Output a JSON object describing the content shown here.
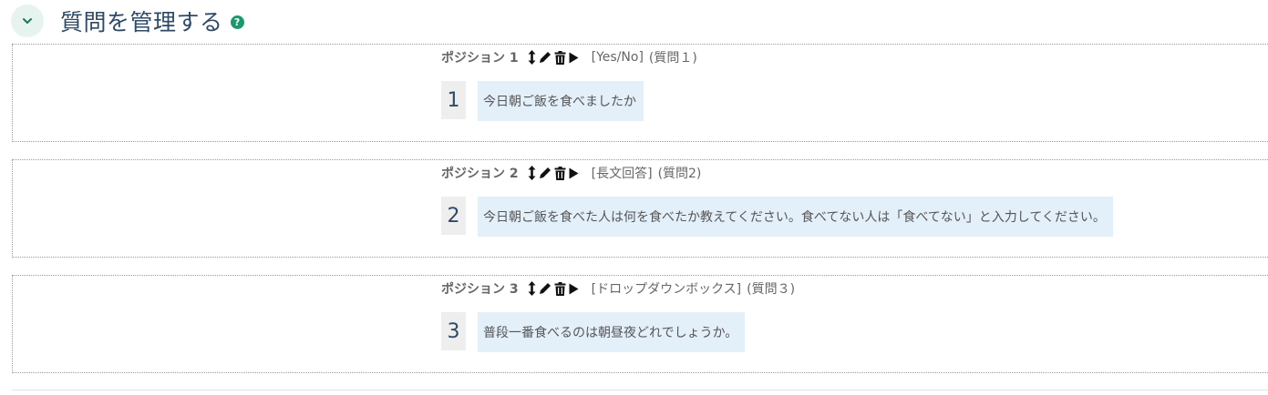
{
  "section": {
    "title": "質問を管理する",
    "help_icon_text": "?",
    "toggle_icon": "chevron-down-icon"
  },
  "colors": {
    "title": "#2e4a66",
    "toggle_bg": "#e6f3ee",
    "help_icon": "#1a9a6c",
    "question_text_bg": "#e3f0fa",
    "number_bg": "#eeeeee"
  },
  "questions": [
    {
      "position_label": "ポジション 1",
      "type": "[Yes/No]",
      "code": "(質問１)",
      "number": "1",
      "text": "今日朝ご飯を食べましたか"
    },
    {
      "position_label": "ポジション 2",
      "type": "[長文回答]",
      "code": "(質問2)",
      "number": "2",
      "text": "今日朝ご飯を食べた人は何を食べたか教えてください。食べてない人は「食べてない」と入力してください。"
    },
    {
      "position_label": "ポジション 3",
      "type": "[ドロップダウンボックス]",
      "code": "(質問３)",
      "number": "3",
      "text": "普段一番食べるのは朝昼夜どれでしょうか。"
    }
  ],
  "tool_icons": [
    "move-icon",
    "edit-icon",
    "delete-icon",
    "preview-icon"
  ]
}
